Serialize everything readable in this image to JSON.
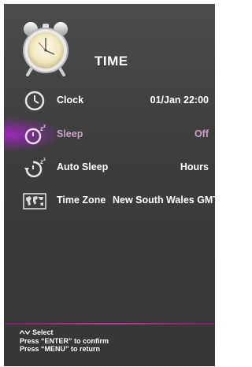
{
  "header": {
    "title": "TIME"
  },
  "menu": {
    "items": [
      {
        "label": "Clock",
        "value": "01/Jan  22:00",
        "icon": "clock-icon"
      },
      {
        "label": "Sleep",
        "value": "Off",
        "icon": "sleep-icon",
        "selected": true
      },
      {
        "label": "Auto Sleep",
        "value": "Hours",
        "icon": "auto-sleep-icon"
      },
      {
        "label": "Time Zone",
        "value": "New South Wales GMT...",
        "icon": "world-map-icon"
      }
    ]
  },
  "footer": {
    "select": "Select",
    "confirm": "Press “ENTER” to confirm",
    "return": "Press “MENU” to return"
  },
  "colors": {
    "background": "#3d3d3d",
    "accent": "#c23a9c",
    "selected_text": "#c8a0c4"
  }
}
